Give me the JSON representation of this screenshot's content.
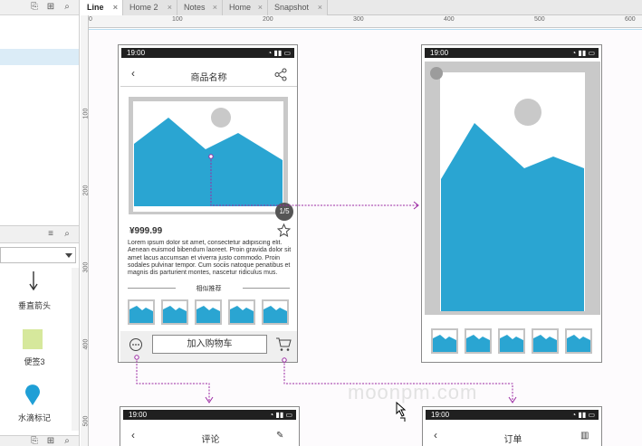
{
  "tabs": [
    {
      "label": "Line",
      "active": true
    },
    {
      "label": "Home 2",
      "active": false
    },
    {
      "label": "Notes",
      "active": false
    },
    {
      "label": "Home",
      "active": false
    },
    {
      "label": "Snapshot",
      "active": false
    }
  ],
  "ruler_h": [
    "0",
    "100",
    "200",
    "300",
    "400",
    "500",
    "600"
  ],
  "ruler_v": [
    "100",
    "200",
    "300",
    "400",
    "500"
  ],
  "widgets": [
    {
      "label": "垂直箭头",
      "icon": "down-arrow-icon"
    },
    {
      "label": "便签3",
      "icon": "sticky-note-icon"
    },
    {
      "label": "水滴标记",
      "icon": "droplet-marker-icon"
    }
  ],
  "phone1": {
    "time": "19:00",
    "title": "商品名称",
    "counter": "1/5",
    "price": "¥999.99",
    "desc": "Lorem ipsum dolor sit amet, consectetur adipiscing elit. Aenean euismod bibendum laoreet. Proin gravida dolor sit amet lacus accumsan et viverra justo commodo. Proin sodales pulvinar tempor. Cum sociis natoque penatibus et magnis dis parturient montes, nascetur ridiculus mus.",
    "related": "相似推荐",
    "cart_button": "加入购物车"
  },
  "phone2": {
    "time": "19:00"
  },
  "phone3": {
    "time": "19:00",
    "title": "评论"
  },
  "phone4": {
    "time": "19:00",
    "title": "订单"
  },
  "watermark": "moonpm.com",
  "colors": {
    "accent": "#2aa5d2",
    "connector": "#9b2aa3",
    "placeholder": "#c9c9c9"
  }
}
